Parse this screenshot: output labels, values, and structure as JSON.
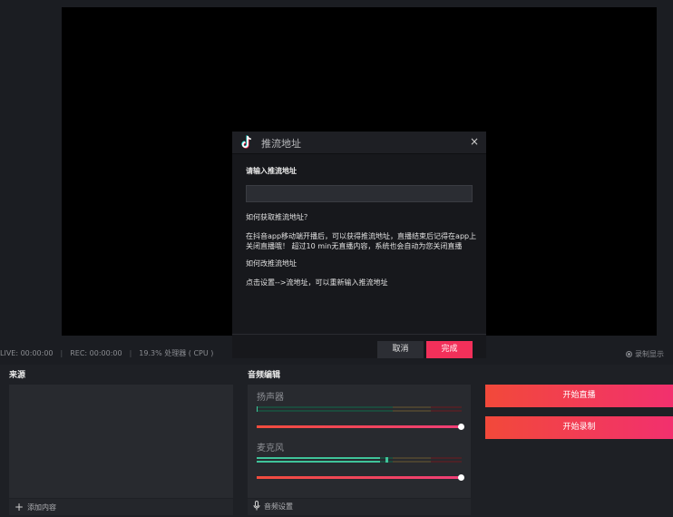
{
  "dialog": {
    "title": "推流地址",
    "close_glyph": "×",
    "url_label": "请输入推流地址",
    "url_value": "",
    "url_placeholder": "",
    "help_title": "如何获取推流地址？",
    "help_text": "在抖音app移动端开播后，可以获得推流地址，直播结束后记得在app上关闭直播哦！ 超过10 min无直播内容，系统也会自动为您关闭直播",
    "change_title": "如何改推流地址",
    "change_text": "点击设置-->流地址，可以重新输入推流地址",
    "cancel_label": "取消",
    "done_label": "完成"
  },
  "status": {
    "live": "LIVE: 00:00:00",
    "rec": "REC: 00:00:00",
    "cpu": "19.3% 处理器 ( CPU )",
    "record_display": "录制显示"
  },
  "sources": {
    "title": "来源",
    "add_label": "添加内容"
  },
  "audio": {
    "title": "音频编辑",
    "channels": [
      {
        "name": "扬声器",
        "meter_level": 0.0,
        "volume": 1.0
      },
      {
        "name": "麦克风",
        "meter_level": 0.6,
        "volume": 1.0
      }
    ],
    "settings_label": "音频设置"
  },
  "actions": {
    "start_live": "开始直播",
    "start_record": "开始录制"
  },
  "colors": {
    "accent": "#f2305a",
    "background": "#1b1d22",
    "panel": "#282a2f"
  },
  "icons": [
    "tiktok-icon",
    "close-icon",
    "plus-icon",
    "microphone-icon",
    "radio-icon"
  ]
}
